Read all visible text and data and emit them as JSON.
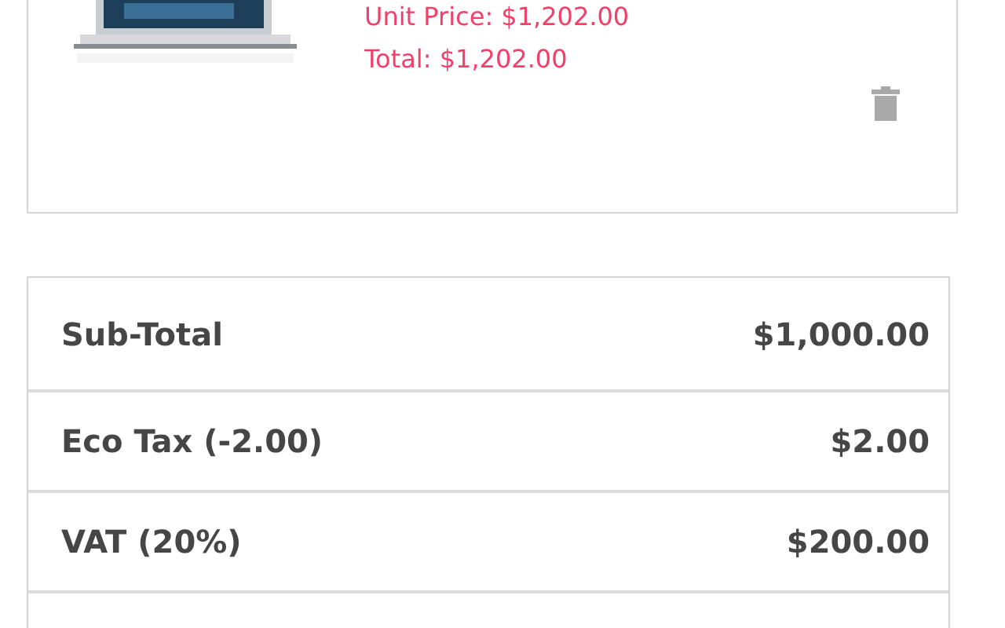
{
  "cart_item": {
    "unit_price": "Unit Price: $1,202.00",
    "total": "Total: $1,202.00"
  },
  "totals": [
    {
      "label": "Sub-Total",
      "value": "$1,000.00"
    },
    {
      "label": "Eco Tax (-2.00)",
      "value": "$2.00"
    },
    {
      "label": "VAT (20%)",
      "value": "$200.00"
    }
  ]
}
